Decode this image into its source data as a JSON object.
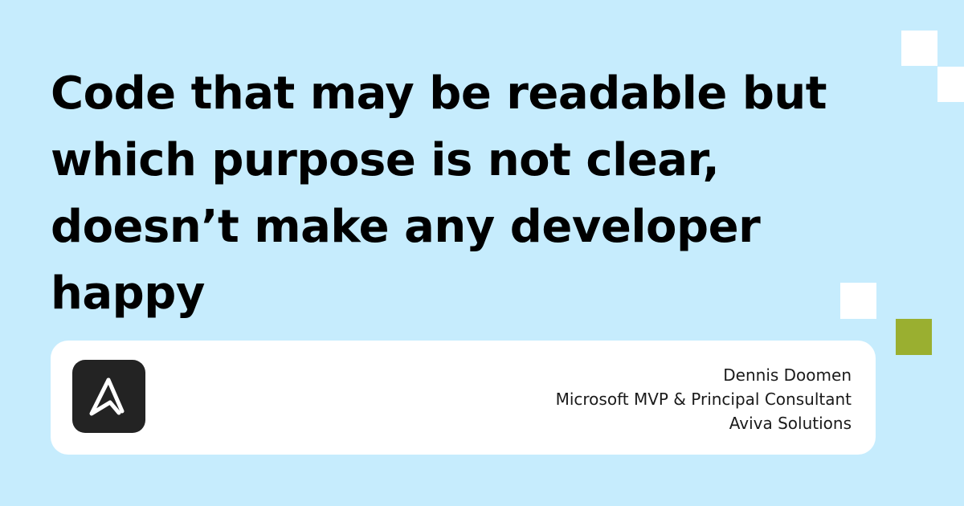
{
  "quote": {
    "lines": [
      "Code that may be readable but",
      "which purpose is not clear,",
      "doesn’t make any developer",
      "happy"
    ]
  },
  "author": {
    "name": "Dennis Doomen",
    "title": "Microsoft MVP & Principal Consultant",
    "company": "Aviva Solutions"
  },
  "logo": {
    "icon": "aviva-a-logo-icon",
    "background": "#232323",
    "foreground": "#ffffff"
  },
  "colors": {
    "background": "#c6ecfd",
    "card": "#ffffff",
    "accent_green": "#9aaf30",
    "text": "#000000"
  }
}
